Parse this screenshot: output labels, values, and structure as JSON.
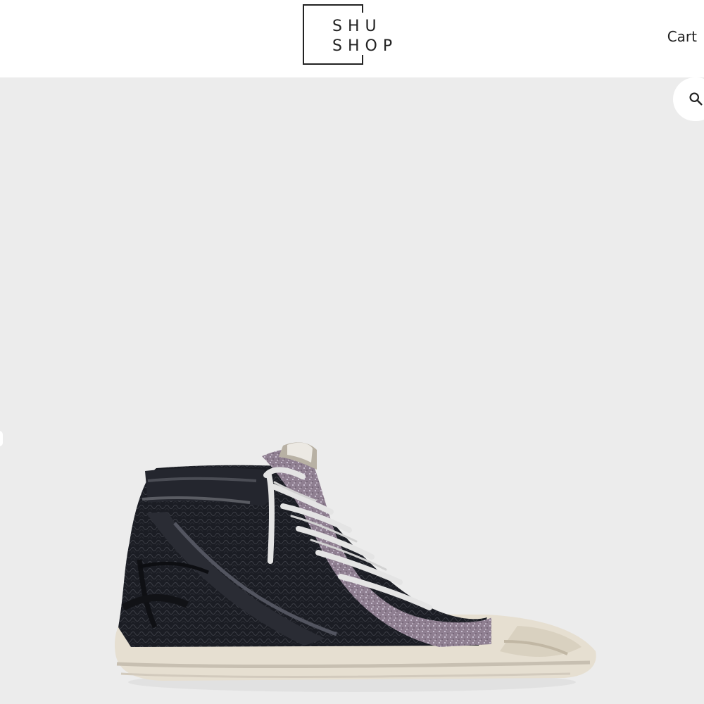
{
  "header": {
    "logo": {
      "line1": "SHU",
      "line2": "SHOP"
    },
    "cart_label": "Cart"
  },
  "hero": {
    "background_color": "#ececec",
    "search_icon": "search-icon"
  },
  "product": {
    "image_icon": "sneaker-image",
    "colors": {
      "upper": "#1b1d24",
      "glitter": "#8f7f91",
      "sole": "#e6dfd1",
      "lace": "#e4e4e4",
      "toe_cap": "#d9d1c0"
    }
  }
}
